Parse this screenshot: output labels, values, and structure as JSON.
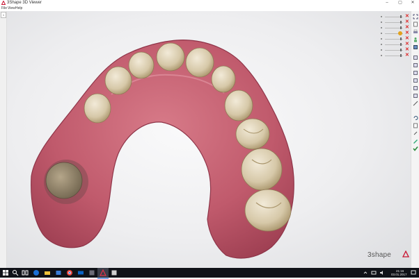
{
  "window": {
    "title": "3Shape 3D Viewer",
    "minimize": "–",
    "maximize": "▢",
    "close": "✕"
  },
  "menu": {
    "items": [
      "File",
      "View",
      "Help"
    ]
  },
  "left_tab": {
    "label": "1"
  },
  "layers": {
    "count": 8,
    "close_glyph": "✕"
  },
  "brand": {
    "text": "3shape"
  },
  "taskbar": {
    "time": "21:16",
    "date": "03.01.2017"
  },
  "icons": {
    "app": "3shape-triangle-icon",
    "search": "search-icon",
    "task_view": "task-view-icon",
    "edge": "edge-browser-icon",
    "explorer": "file-explorer-icon",
    "chrome": "chrome-icon",
    "store": "store-icon",
    "mail": "mail-icon",
    "viewer": "3shape-viewer-taskbar-icon",
    "other": "app-icon"
  },
  "colors": {
    "accent": "#c8102e",
    "gum": "#c05a6c",
    "tooth": "#d6c8a8",
    "taskbar": "#101218"
  }
}
